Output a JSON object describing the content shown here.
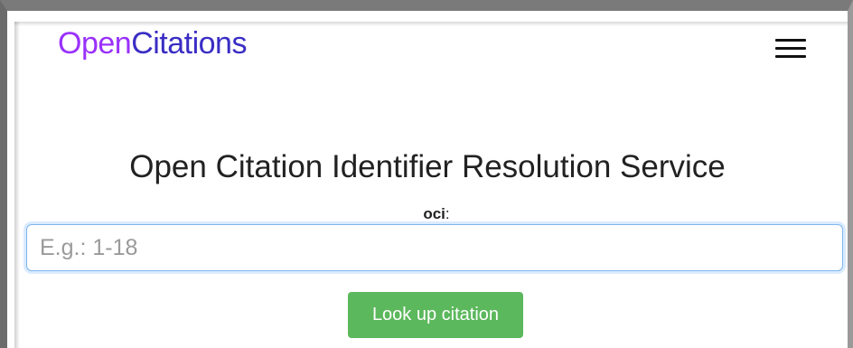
{
  "navbar": {
    "brand_part1": "Open",
    "brand_part2": "Citations",
    "menu_icon": "hamburger-menu-icon"
  },
  "main": {
    "title": "Open Citation Identifier Resolution Service",
    "field_label": "oci",
    "field_label_suffix": ":",
    "input": {
      "value": "",
      "placeholder": "E.g.: 1-18"
    },
    "submit_label": "Look up citation"
  },
  "colors": {
    "brand_open": "#9931fc",
    "brand_citations": "#3a2dc4",
    "button_bg": "#5cb85c",
    "input_focus_border": "#7fb6ee"
  }
}
